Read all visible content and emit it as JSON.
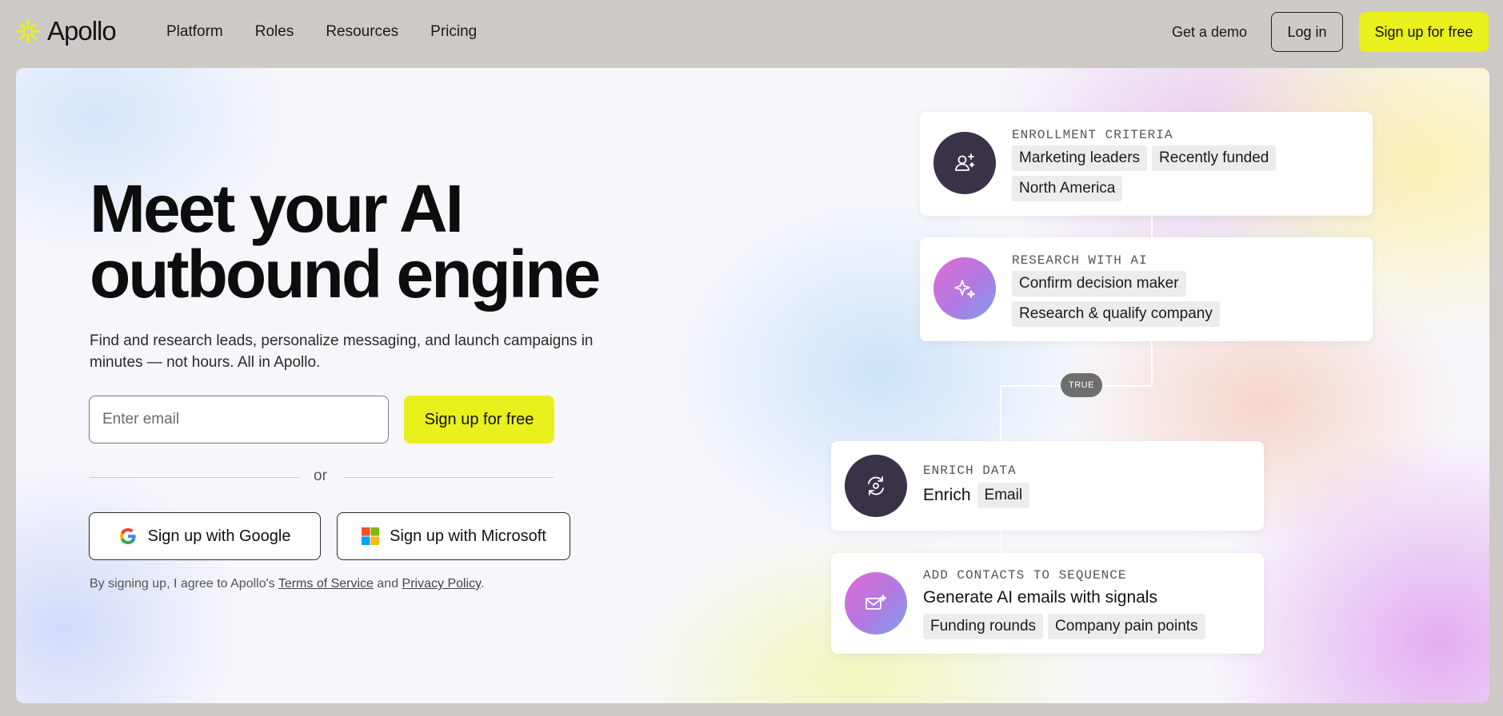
{
  "brand": {
    "name": "Apollo",
    "accent": "#e9f01c"
  },
  "nav": {
    "links": [
      "Platform",
      "Roles",
      "Resources",
      "Pricing"
    ],
    "demo": "Get a demo",
    "login": "Log in",
    "signup": "Sign up for free"
  },
  "hero": {
    "headline_line1": "Meet your AI",
    "headline_line2": "outbound engine",
    "subtext": "Find and research leads, personalize messaging, and launch campaigns in minutes — not hours. All in Apollo.",
    "email_placeholder": "Enter email",
    "signup_button": "Sign up for free",
    "or": "or",
    "google_button": "Sign up with Google",
    "microsoft_button": "Sign up with Microsoft",
    "legal_prefix": "By signing up, I agree to Apollo's ",
    "terms": "Terms of Service",
    "legal_and": " and ",
    "privacy": "Privacy Policy",
    "legal_suffix": "."
  },
  "workflow": {
    "true_badge": "TRUE",
    "cards": [
      {
        "label": "ENROLLMENT CRITERIA",
        "icon": "user-sparkle-icon",
        "chips": [
          "Marketing leaders",
          "Recently funded",
          "North America"
        ]
      },
      {
        "label": "RESEARCH WITH AI",
        "icon": "sparkle-icon",
        "chips": [
          "Confirm decision maker",
          "Research & qualify company"
        ]
      },
      {
        "label": "ENRICH DATA",
        "icon": "refresh-icon",
        "title": "Enrich",
        "chips": [
          "Email"
        ]
      },
      {
        "label": "ADD CONTACTS TO SEQUENCE",
        "icon": "mail-sparkle-icon",
        "title": "Generate AI emails with signals",
        "chips": [
          "Funding rounds",
          "Company pain points"
        ]
      }
    ]
  }
}
